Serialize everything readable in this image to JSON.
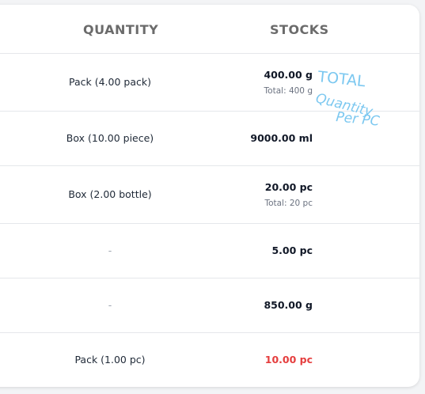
{
  "table": {
    "headers": {
      "quantity": "QUANTITY",
      "stocks": "STOCKS"
    },
    "rows": [
      {
        "quantity": "Pack (4.00 pack)",
        "stock": "400.00 g",
        "total": "Total: 400 g"
      },
      {
        "quantity": "Box (10.00 piece)",
        "stock": "9000.00 ml",
        "total": ""
      },
      {
        "quantity": "Box (2.00 bottle)",
        "stock": "20.00 pc",
        "total": "Total: 20 pc"
      },
      {
        "quantity": "-",
        "stock": "5.00 pc",
        "total": ""
      },
      {
        "quantity": "-",
        "stock": "850.00 g",
        "total": ""
      },
      {
        "quantity": "Pack (1.00 pc)",
        "stock": "10.00 pc",
        "total": "",
        "status": "low"
      }
    ]
  },
  "annotation": {
    "lines": [
      "TOTAL",
      "Quantity",
      "Per PC"
    ],
    "color": "#7cc8f0"
  },
  "colors": {
    "low_stock": "#e53e3e",
    "header_text": "#6b6b6b"
  }
}
